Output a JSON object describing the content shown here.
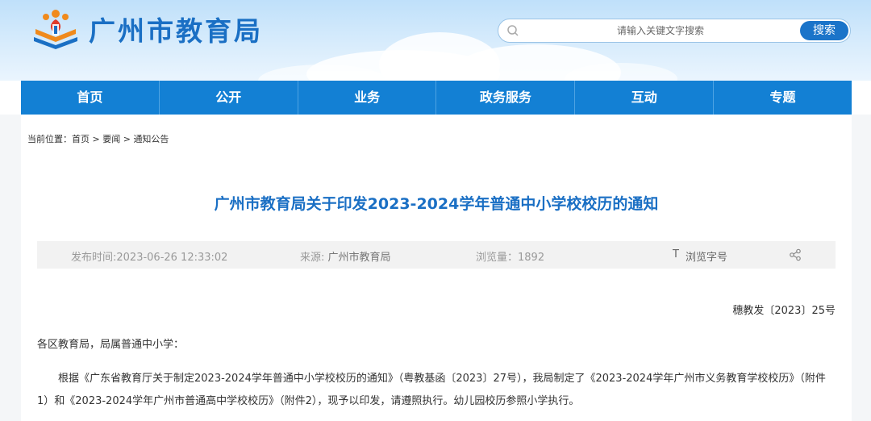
{
  "header": {
    "site_name": "广州市教育局",
    "search": {
      "placeholder": "请输入关键文字搜索",
      "button_label": "搜索"
    }
  },
  "nav": {
    "items": [
      {
        "label": "首页"
      },
      {
        "label": "公开"
      },
      {
        "label": "业务"
      },
      {
        "label": "政务服务"
      },
      {
        "label": "互动"
      },
      {
        "label": "专题"
      }
    ]
  },
  "breadcrumb": {
    "prefix": "当前位置：",
    "items": [
      "首页",
      "要闻",
      "通知公告"
    ],
    "separator": ">"
  },
  "article": {
    "title": "广州市教育局关于印发2023-2024学年普通中小学校校历的通知",
    "meta": {
      "publish_time": "发布时间:2023-06-26 12:33:02",
      "source_label": "来源: ",
      "source_value": "广州市教育局",
      "views": "浏览量：1892",
      "font_size_icon": "T",
      "font_size_label": "浏览字号"
    },
    "doc_number": "穗教发〔2023〕25号",
    "salutation": "各区教育局，局属普通中小学：",
    "body": "根据《广东省教育厅关于制定2023-2024学年普通中小学校校历的通知》（粤教基函〔2023〕27号），我局制定了《2023-2024学年广州市义务教育学校校历》（附件1）和《2023-2024学年广州市普通高中学校校历》（附件2），现予以印发，请遵照执行。幼儿园校历参照小学执行。"
  },
  "colors": {
    "brand_blue": "#1a6fc4",
    "nav_blue": "#1380d4",
    "logo_orange": "#f08a1c",
    "logo_red": "#e03a2a"
  },
  "icons": [
    "logo-emblem-icon",
    "search-icon",
    "share-icon"
  ]
}
